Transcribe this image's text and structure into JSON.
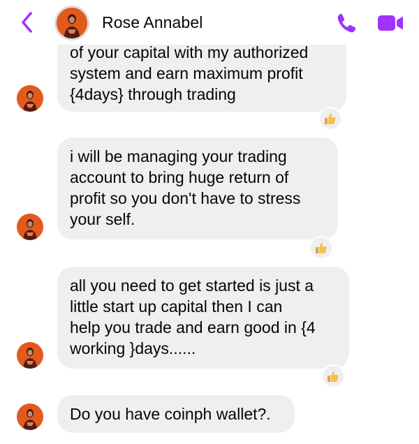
{
  "header": {
    "contact_name": "Rose Annabel",
    "back_icon": "chevron-left-icon",
    "call_icon": "phone-icon",
    "video_icon": "video-camera-icon",
    "accent_color": "#a033ff"
  },
  "messages": [
    {
      "text": "of your capital with my authorized\nsystem and earn maximum profit\n{4days} through trading",
      "reaction": "thumbs-up"
    },
    {
      "text": "i will be managing your trading\naccount to bring huge return of\nprofit so you don't have to stress\nyour self.",
      "reaction": "thumbs-up"
    },
    {
      "text": "all you need to get started is just a\nlittle start up capital then I can\nhelp you trade and earn good in {4\nworking }days......",
      "reaction": "thumbs-up"
    },
    {
      "text": "Do you have coinph wallet?.",
      "reaction": null
    }
  ]
}
